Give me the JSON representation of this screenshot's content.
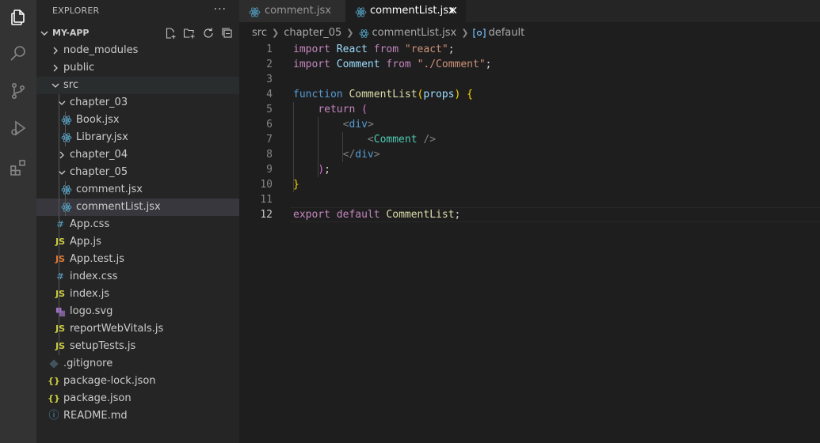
{
  "activity_bar": {
    "items": [
      {
        "icon": "files-icon",
        "active": true
      },
      {
        "icon": "search-icon",
        "active": false
      },
      {
        "icon": "source-control-icon",
        "active": false
      },
      {
        "icon": "run-debug-icon",
        "active": false
      },
      {
        "icon": "extensions-icon",
        "active": false
      }
    ]
  },
  "sidebar": {
    "title": "EXPLORER",
    "more_label": "···",
    "project": "MY-APP",
    "actions": [
      "new-file-icon",
      "new-folder-icon",
      "refresh-icon",
      "collapse-all-icon"
    ],
    "tree": [
      {
        "label": "node_modules",
        "type": "folder",
        "expanded": false,
        "depth": 0
      },
      {
        "label": "public",
        "type": "folder",
        "expanded": false,
        "depth": 0
      },
      {
        "label": "src",
        "type": "folder",
        "expanded": true,
        "depth": 0
      },
      {
        "label": "chapter_03",
        "type": "folder",
        "expanded": true,
        "depth": 1
      },
      {
        "label": "Book.jsx",
        "type": "react",
        "depth": 2
      },
      {
        "label": "Library.jsx",
        "type": "react",
        "depth": 2
      },
      {
        "label": "chapter_04",
        "type": "folder",
        "expanded": false,
        "depth": 1
      },
      {
        "label": "chapter_05",
        "type": "folder",
        "expanded": true,
        "depth": 1
      },
      {
        "label": "comment.jsx",
        "type": "react",
        "depth": 2
      },
      {
        "label": "commentList.jsx",
        "type": "react",
        "depth": 2,
        "selected": true
      },
      {
        "label": "App.css",
        "type": "css",
        "icon_text": "#",
        "depth": 1
      },
      {
        "label": "App.js",
        "type": "js",
        "icon_text": "JS",
        "depth": 1
      },
      {
        "label": "App.test.js",
        "type": "test",
        "icon_text": "JS",
        "depth": 1
      },
      {
        "label": "index.css",
        "type": "css",
        "icon_text": "#",
        "depth": 1
      },
      {
        "label": "index.js",
        "type": "js",
        "icon_text": "JS",
        "depth": 1
      },
      {
        "label": "logo.svg",
        "type": "svg",
        "depth": 1
      },
      {
        "label": "reportWebVitals.js",
        "type": "js",
        "icon_text": "JS",
        "depth": 1
      },
      {
        "label": "setupTests.js",
        "type": "js",
        "icon_text": "JS",
        "depth": 1
      },
      {
        "label": ".gitignore",
        "type": "git",
        "depth": 0
      },
      {
        "label": "package-lock.json",
        "type": "json",
        "icon_text": "{}",
        "depth": 0
      },
      {
        "label": "package.json",
        "type": "json",
        "icon_text": "{}",
        "depth": 0
      },
      {
        "label": "README.md",
        "type": "info",
        "icon_text": "ⓘ",
        "depth": 0
      }
    ]
  },
  "tabs": [
    {
      "label": "comment.jsx",
      "active": false
    },
    {
      "label": "commentList.jsx",
      "active": true,
      "close": "✕"
    }
  ],
  "breadcrumb": [
    "src",
    "chapter_05",
    "commentList.jsx",
    "default"
  ],
  "editor": {
    "current_line": 12,
    "line_numbers": [
      "1",
      "2",
      "3",
      "4",
      "5",
      "6",
      "7",
      "8",
      "9",
      "10",
      "11",
      "12"
    ],
    "lines": [
      [
        {
          "t": "import",
          "c": "kw"
        },
        {
          "t": " "
        },
        {
          "t": "React",
          "c": "var"
        },
        {
          "t": " "
        },
        {
          "t": "from",
          "c": "kw"
        },
        {
          "t": " "
        },
        {
          "t": "\"react\"",
          "c": "str"
        },
        {
          "t": ";"
        }
      ],
      [
        {
          "t": "import",
          "c": "kw"
        },
        {
          "t": " "
        },
        {
          "t": "Comment",
          "c": "var"
        },
        {
          "t": " "
        },
        {
          "t": "from",
          "c": "kw"
        },
        {
          "t": " "
        },
        {
          "t": "\"./Comment\"",
          "c": "str"
        },
        {
          "t": ";"
        }
      ],
      [],
      [
        {
          "t": "function",
          "c": "kw2"
        },
        {
          "t": " "
        },
        {
          "t": "CommentList",
          "c": "fn"
        },
        {
          "t": "(",
          "c": "br1"
        },
        {
          "t": "props",
          "c": "var"
        },
        {
          "t": ")",
          "c": "br1"
        },
        {
          "t": " "
        },
        {
          "t": "{",
          "c": "br1"
        }
      ],
      [
        {
          "t": "    "
        },
        {
          "t": "return",
          "c": "kw"
        },
        {
          "t": " "
        },
        {
          "t": "(",
          "c": "br2"
        }
      ],
      [
        {
          "t": "        "
        },
        {
          "t": "<",
          "c": "punc"
        },
        {
          "t": "div",
          "c": "tag"
        },
        {
          "t": ">",
          "c": "punc"
        }
      ],
      [
        {
          "t": "            "
        },
        {
          "t": "<",
          "c": "punc"
        },
        {
          "t": "Comment",
          "c": "comp"
        },
        {
          "t": " "
        },
        {
          "t": "/>",
          "c": "punc"
        }
      ],
      [
        {
          "t": "        "
        },
        {
          "t": "</",
          "c": "punc"
        },
        {
          "t": "div",
          "c": "tag"
        },
        {
          "t": ">",
          "c": "punc"
        }
      ],
      [
        {
          "t": "    "
        },
        {
          "t": ")",
          "c": "br2"
        },
        {
          "t": ";"
        }
      ],
      [
        {
          "t": "}",
          "c": "br1"
        }
      ],
      [],
      [
        {
          "t": "export",
          "c": "kw"
        },
        {
          "t": " "
        },
        {
          "t": "default",
          "c": "kw"
        },
        {
          "t": " "
        },
        {
          "t": "CommentList",
          "c": "fn"
        },
        {
          "t": ";"
        }
      ]
    ]
  },
  "colors": {
    "editor_bg": "#1e1e1e",
    "sidebar_bg": "#252526",
    "activity_bg": "#333333",
    "react_icon": "#519aba"
  }
}
